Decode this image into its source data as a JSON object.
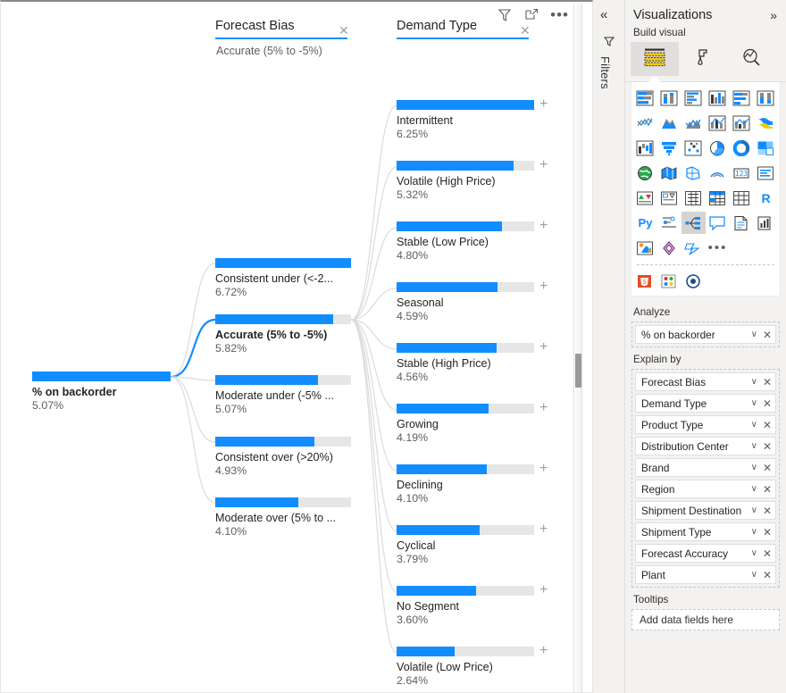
{
  "canvas": {
    "root": {
      "label": "% on backorder",
      "value": "5.07%",
      "bar_ratio": 1.0
    },
    "columns": [
      {
        "title": "Forecast Bias",
        "close_icon": "close-icon",
        "selected_value": "Accurate (5% to -5%)"
      },
      {
        "title": "Demand Type",
        "close_icon": "close-icon",
        "selected_value": ""
      }
    ],
    "level1": [
      {
        "label": "Consistent under (<-2...",
        "value": "6.72%",
        "bar_ratio": 1.0,
        "selected": false
      },
      {
        "label": "Accurate (5% to -5%)",
        "value": "5.82%",
        "bar_ratio": 0.866,
        "selected": true
      },
      {
        "label": "Moderate under (-5% ...",
        "value": "5.07%",
        "bar_ratio": 0.754,
        "selected": false
      },
      {
        "label": "Consistent over (>20%)",
        "value": "4.93%",
        "bar_ratio": 0.733,
        "selected": false
      },
      {
        "label": "Moderate over (5% to ...",
        "value": "4.10%",
        "bar_ratio": 0.61,
        "selected": false
      }
    ],
    "level2": [
      {
        "label": "Intermittent",
        "value": "6.25%",
        "bar_ratio": 1.0
      },
      {
        "label": "Volatile (High Price)",
        "value": "5.32%",
        "bar_ratio": 0.851
      },
      {
        "label": "Stable (Low Price)",
        "value": "4.80%",
        "bar_ratio": 0.768
      },
      {
        "label": "Seasonal",
        "value": "4.59%",
        "bar_ratio": 0.734
      },
      {
        "label": "Stable (High Price)",
        "value": "4.56%",
        "bar_ratio": 0.73
      },
      {
        "label": "Growing",
        "value": "4.19%",
        "bar_ratio": 0.67
      },
      {
        "label": "Declining",
        "value": "4.10%",
        "bar_ratio": 0.656
      },
      {
        "label": "Cyclical",
        "value": "3.79%",
        "bar_ratio": 0.606
      },
      {
        "label": "No Segment",
        "value": "3.60%",
        "bar_ratio": 0.576
      },
      {
        "label": "Volatile (Low Price)",
        "value": "2.64%",
        "bar_ratio": 0.422
      }
    ],
    "expand_glyph": "+",
    "toolbar": [
      {
        "name": "filter-icon",
        "glyph": "filter"
      },
      {
        "name": "focus-mode-icon",
        "glyph": "focus"
      },
      {
        "name": "more-options-icon",
        "glyph": "•••"
      }
    ]
  },
  "filters_rail": {
    "collapse_icon": "«",
    "filter_icon": "filter-arrow-icon",
    "label": "Filters"
  },
  "viz_pane": {
    "title": "Visualizations",
    "expand_icon": "»",
    "subtitle": "Build visual",
    "tabs": [
      {
        "name": "build-visual-tab",
        "icon": "fields-icon",
        "active": true
      },
      {
        "name": "format-visual-tab",
        "icon": "paintbrush-icon",
        "active": false
      },
      {
        "name": "analytics-tab",
        "icon": "magnifier-chart-icon",
        "active": false
      }
    ],
    "icons": [
      "stacked-bar-chart-icon",
      "stacked-column-chart-icon",
      "clustered-bar-chart-icon",
      "clustered-column-chart-icon",
      "hundred-percent-stacked-bar-icon",
      "hundred-percent-stacked-column-icon",
      "line-chart-icon",
      "area-chart-icon",
      "stacked-area-chart-icon",
      "line-and-stacked-column-icon",
      "line-and-clustered-column-icon",
      "ribbon-chart-icon",
      "waterfall-chart-icon",
      "funnel-icon",
      "scatter-chart-icon",
      "pie-chart-icon",
      "donut-chart-icon",
      "treemap-icon",
      "map-icon",
      "filled-map-icon",
      "shape-map-icon",
      "azure-map-icon",
      "gauge-icon",
      "card-icon",
      "multi-row-card-icon",
      "kpi-icon",
      "slicer-icon",
      "table-icon",
      "matrix-icon",
      "r-script-visual-icon",
      "python-visual-icon",
      "key-influencers-icon",
      "decomposition-tree-icon",
      "qna-icon",
      "smart-narrative-icon",
      "metrics-icon",
      "paginated-report-icon",
      "power-apps-icon",
      "power-automate-icon",
      "more-visuals-icon",
      "html-viewer-icon",
      "visio-icon",
      "arcgis-maps-icon"
    ],
    "selected_icon": "decomposition-tree-icon",
    "wells": [
      {
        "title": "Analyze",
        "name": "analyze-well",
        "fields": [
          {
            "label": "% on backorder"
          }
        ]
      },
      {
        "title": "Explain by",
        "name": "explain-by-well",
        "fields": [
          {
            "label": "Forecast Bias"
          },
          {
            "label": "Demand Type"
          },
          {
            "label": "Product Type"
          },
          {
            "label": "Distribution Center"
          },
          {
            "label": "Brand"
          },
          {
            "label": "Region"
          },
          {
            "label": "Shipment Destination"
          },
          {
            "label": "Shipment Type"
          },
          {
            "label": "Forecast Accuracy"
          },
          {
            "label": "Plant"
          }
        ]
      }
    ],
    "tooltips": {
      "title": "Tooltips",
      "placeholder": "Add data fields here"
    },
    "chip_chevron": "∨",
    "chip_close": "✕"
  },
  "colors": {
    "accent": "#118DFF",
    "track": "#E6E6E6",
    "text": "#252423",
    "muted": "#605E5C",
    "pane_bg": "#F3F2F1"
  }
}
